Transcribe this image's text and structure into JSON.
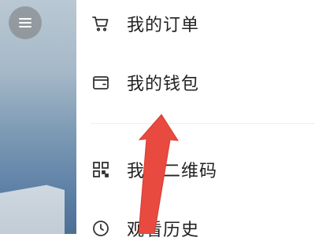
{
  "menu": {
    "items": [
      {
        "label": "我的订单",
        "icon": "cart-icon"
      },
      {
        "label": "我的钱包",
        "icon": "wallet-icon"
      },
      {
        "label": "我的二维码",
        "icon": "qr-code-icon"
      },
      {
        "label": "观看历史",
        "icon": "clock-icon"
      }
    ]
  },
  "colors": {
    "annotation_arrow": "#e84a3f",
    "icon_stroke": "#333333"
  }
}
